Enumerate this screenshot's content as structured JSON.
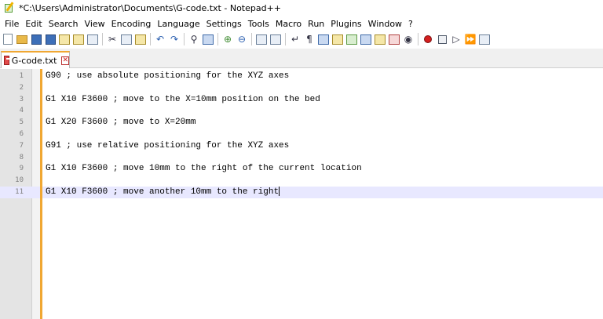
{
  "window": {
    "title": "*C:\\Users\\Administrator\\Documents\\G-code.txt - Notepad++",
    "icon": "notepad-plus-plus-icon"
  },
  "menu": {
    "items": [
      "File",
      "Edit",
      "Search",
      "View",
      "Encoding",
      "Language",
      "Settings",
      "Tools",
      "Macro",
      "Run",
      "Plugins",
      "Window",
      "?"
    ]
  },
  "toolbar": {
    "icons": [
      "new-file-icon",
      "open-file-icon",
      "save-icon",
      "save-all-icon",
      "close-icon",
      "close-all-icon",
      "print-icon",
      "cut-icon",
      "copy-icon",
      "paste-icon",
      "undo-icon",
      "redo-icon",
      "find-icon",
      "replace-icon",
      "zoom-in-icon",
      "zoom-out-icon",
      "sync-vertical-icon",
      "sync-horizontal-icon",
      "word-wrap-icon",
      "show-all-chars-icon",
      "indent-guide-icon",
      "user-language-icon",
      "document-map-icon",
      "function-list-icon",
      "folder-workspace-icon",
      "monitoring-icon",
      "record-macro-icon",
      "stop-macro-icon",
      "play-macro-icon",
      "run-macro-multiple-icon",
      "save-macro-icon"
    ]
  },
  "tab": {
    "label": "G-code.txt",
    "icon": "unsaved-file-icon"
  },
  "colors": {
    "accent_orange": "#f0a732",
    "current_line": "#e8e8ff",
    "gutter": "#e4e4e4"
  },
  "editor": {
    "lines": [
      {
        "n": "1",
        "text": "G90 ; use absolute positioning for the XYZ axes"
      },
      {
        "n": "2",
        "text": ""
      },
      {
        "n": "3",
        "text": "G1 X10 F3600 ; move to the X=10mm position on the bed"
      },
      {
        "n": "4",
        "text": ""
      },
      {
        "n": "5",
        "text": "G1 X20 F3600 ; move to X=20mm"
      },
      {
        "n": "6",
        "text": ""
      },
      {
        "n": "7",
        "text": "G91 ; use relative positioning for the XYZ axes"
      },
      {
        "n": "8",
        "text": ""
      },
      {
        "n": "9",
        "text": "G1 X10 F3600 ; move 10mm to the right of the current location"
      },
      {
        "n": "10",
        "text": ""
      },
      {
        "n": "11",
        "text": "G1 X10 F3600 ; move another 10mm to the right"
      }
    ],
    "current_line": "11"
  }
}
